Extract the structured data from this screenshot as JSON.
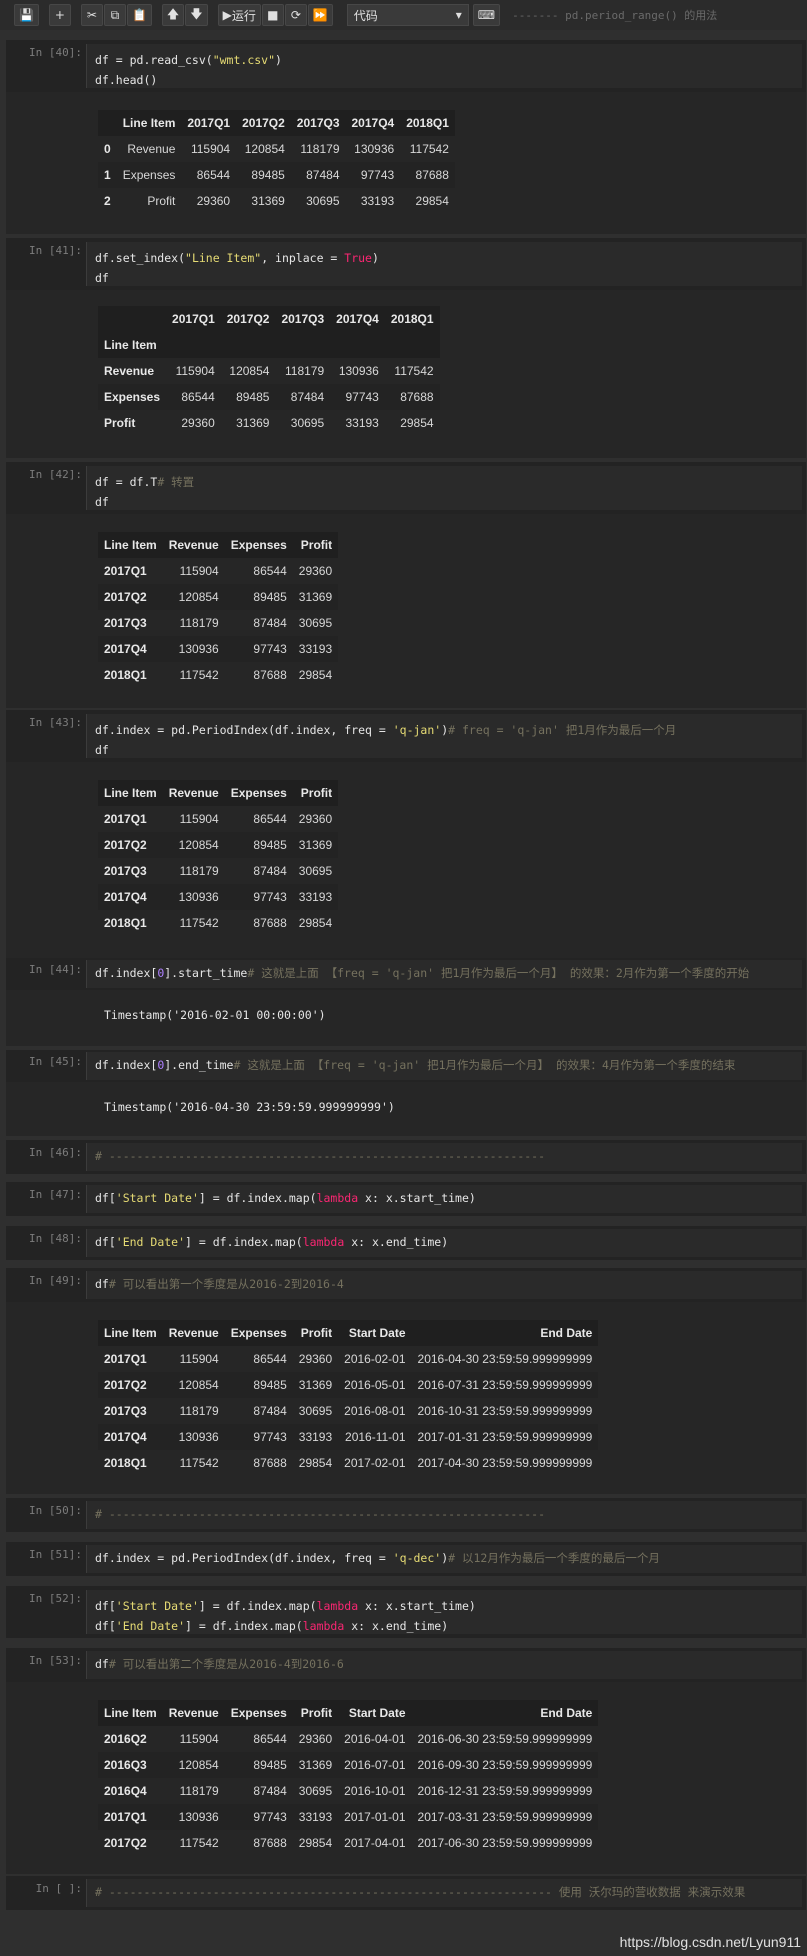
{
  "toolbar": {
    "run_label": "运行",
    "cell_type": "代码",
    "comment": "------- pd.period_range() 的用法"
  },
  "cells": {
    "c40": {
      "prompt": "In [40]:"
    },
    "c41": {
      "prompt": "In [41]:"
    },
    "c42": {
      "prompt": "In [42]:",
      "comment": "# 转置"
    },
    "c43": {
      "prompt": "In [43]:",
      "comment": "# freq = 'q-jan' 把1月作为最后一个月"
    },
    "c44": {
      "prompt": "In [44]:",
      "comment": "# 这就是上面 【freq = 'q-jan' 把1月作为最后一个月】 的效果：2月作为第一个季度的开始",
      "output": "Timestamp('2016-02-01 00:00:00')"
    },
    "c45": {
      "prompt": "In [45]:",
      "comment": "# 这就是上面 【freq = 'q-jan' 把1月作为最后一个月】 的效果：4月作为第一个季度的结束",
      "output": "Timestamp('2016-04-30 23:59:59.999999999')"
    },
    "c46": {
      "prompt": "In [46]:",
      "comment": "# ---------------------------------------------------------------"
    },
    "c47": {
      "prompt": "In [47]:"
    },
    "c48": {
      "prompt": "In [48]:"
    },
    "c49": {
      "prompt": "In [49]:",
      "comment": "# 可以看出第一个季度是从2016-2到2016-4"
    },
    "c50": {
      "prompt": "In [50]:",
      "comment": "# ---------------------------------------------------------------"
    },
    "c51": {
      "prompt": "In [51]:",
      "comment": "# 以12月作为最后一个季度的最后一个月"
    },
    "c52": {
      "prompt": "In [52]:"
    },
    "c53": {
      "prompt": "In [53]:",
      "comment": "# 可以看出第二个季度是从2016-4到2016-6"
    },
    "c54": {
      "prompt": "In [ ]:",
      "comment": "# ---------------------------------------------------------------- 使用 沃尔玛的营收数据 来演示效果"
    }
  },
  "tables": {
    "t40": {
      "columns": [
        "",
        "Line Item",
        "2017Q1",
        "2017Q2",
        "2017Q3",
        "2017Q4",
        "2018Q1"
      ],
      "rows": [
        [
          "0",
          "Revenue",
          "115904",
          "120854",
          "118179",
          "130936",
          "117542"
        ],
        [
          "1",
          "Expenses",
          "86544",
          "89485",
          "87484",
          "97743",
          "87688"
        ],
        [
          "2",
          "Profit",
          "29360",
          "31369",
          "30695",
          "33193",
          "29854"
        ]
      ]
    },
    "t41": {
      "columns": [
        "",
        "2017Q1",
        "2017Q2",
        "2017Q3",
        "2017Q4",
        "2018Q1"
      ],
      "index_name": "Line Item",
      "rows": [
        [
          "Revenue",
          "115904",
          "120854",
          "118179",
          "130936",
          "117542"
        ],
        [
          "Expenses",
          "86544",
          "89485",
          "87484",
          "97743",
          "87688"
        ],
        [
          "Profit",
          "29360",
          "31369",
          "30695",
          "33193",
          "29854"
        ]
      ]
    },
    "t42": {
      "columns": [
        "Line Item",
        "Revenue",
        "Expenses",
        "Profit"
      ],
      "rows": [
        [
          "2017Q1",
          "115904",
          "86544",
          "29360"
        ],
        [
          "2017Q2",
          "120854",
          "89485",
          "31369"
        ],
        [
          "2017Q3",
          "118179",
          "87484",
          "30695"
        ],
        [
          "2017Q4",
          "130936",
          "97743",
          "33193"
        ],
        [
          "2018Q1",
          "117542",
          "87688",
          "29854"
        ]
      ]
    },
    "t43": {
      "columns": [
        "Line Item",
        "Revenue",
        "Expenses",
        "Profit"
      ],
      "rows": [
        [
          "2017Q1",
          "115904",
          "86544",
          "29360"
        ],
        [
          "2017Q2",
          "120854",
          "89485",
          "31369"
        ],
        [
          "2017Q3",
          "118179",
          "87484",
          "30695"
        ],
        [
          "2017Q4",
          "130936",
          "97743",
          "33193"
        ],
        [
          "2018Q1",
          "117542",
          "87688",
          "29854"
        ]
      ]
    },
    "t49": {
      "columns": [
        "Line Item",
        "Revenue",
        "Expenses",
        "Profit",
        "Start Date",
        "End Date"
      ],
      "rows": [
        [
          "2017Q1",
          "115904",
          "86544",
          "29360",
          "2016-02-01",
          "2016-04-30 23:59:59.999999999"
        ],
        [
          "2017Q2",
          "120854",
          "89485",
          "31369",
          "2016-05-01",
          "2016-07-31 23:59:59.999999999"
        ],
        [
          "2017Q3",
          "118179",
          "87484",
          "30695",
          "2016-08-01",
          "2016-10-31 23:59:59.999999999"
        ],
        [
          "2017Q4",
          "130936",
          "97743",
          "33193",
          "2016-11-01",
          "2017-01-31 23:59:59.999999999"
        ],
        [
          "2018Q1",
          "117542",
          "87688",
          "29854",
          "2017-02-01",
          "2017-04-30 23:59:59.999999999"
        ]
      ]
    },
    "t53": {
      "columns": [
        "Line Item",
        "Revenue",
        "Expenses",
        "Profit",
        "Start Date",
        "End Date"
      ],
      "rows": [
        [
          "2016Q2",
          "115904",
          "86544",
          "29360",
          "2016-04-01",
          "2016-06-30 23:59:59.999999999"
        ],
        [
          "2016Q3",
          "120854",
          "89485",
          "31369",
          "2016-07-01",
          "2016-09-30 23:59:59.999999999"
        ],
        [
          "2016Q4",
          "118179",
          "87484",
          "30695",
          "2016-10-01",
          "2016-12-31 23:59:59.999999999"
        ],
        [
          "2017Q1",
          "130936",
          "97743",
          "33193",
          "2017-01-01",
          "2017-03-31 23:59:59.999999999"
        ],
        [
          "2017Q2",
          "117542",
          "87688",
          "29854",
          "2017-04-01",
          "2017-06-30 23:59:59.999999999"
        ]
      ]
    }
  },
  "watermark": "https://blog.csdn.net/Lyun911"
}
